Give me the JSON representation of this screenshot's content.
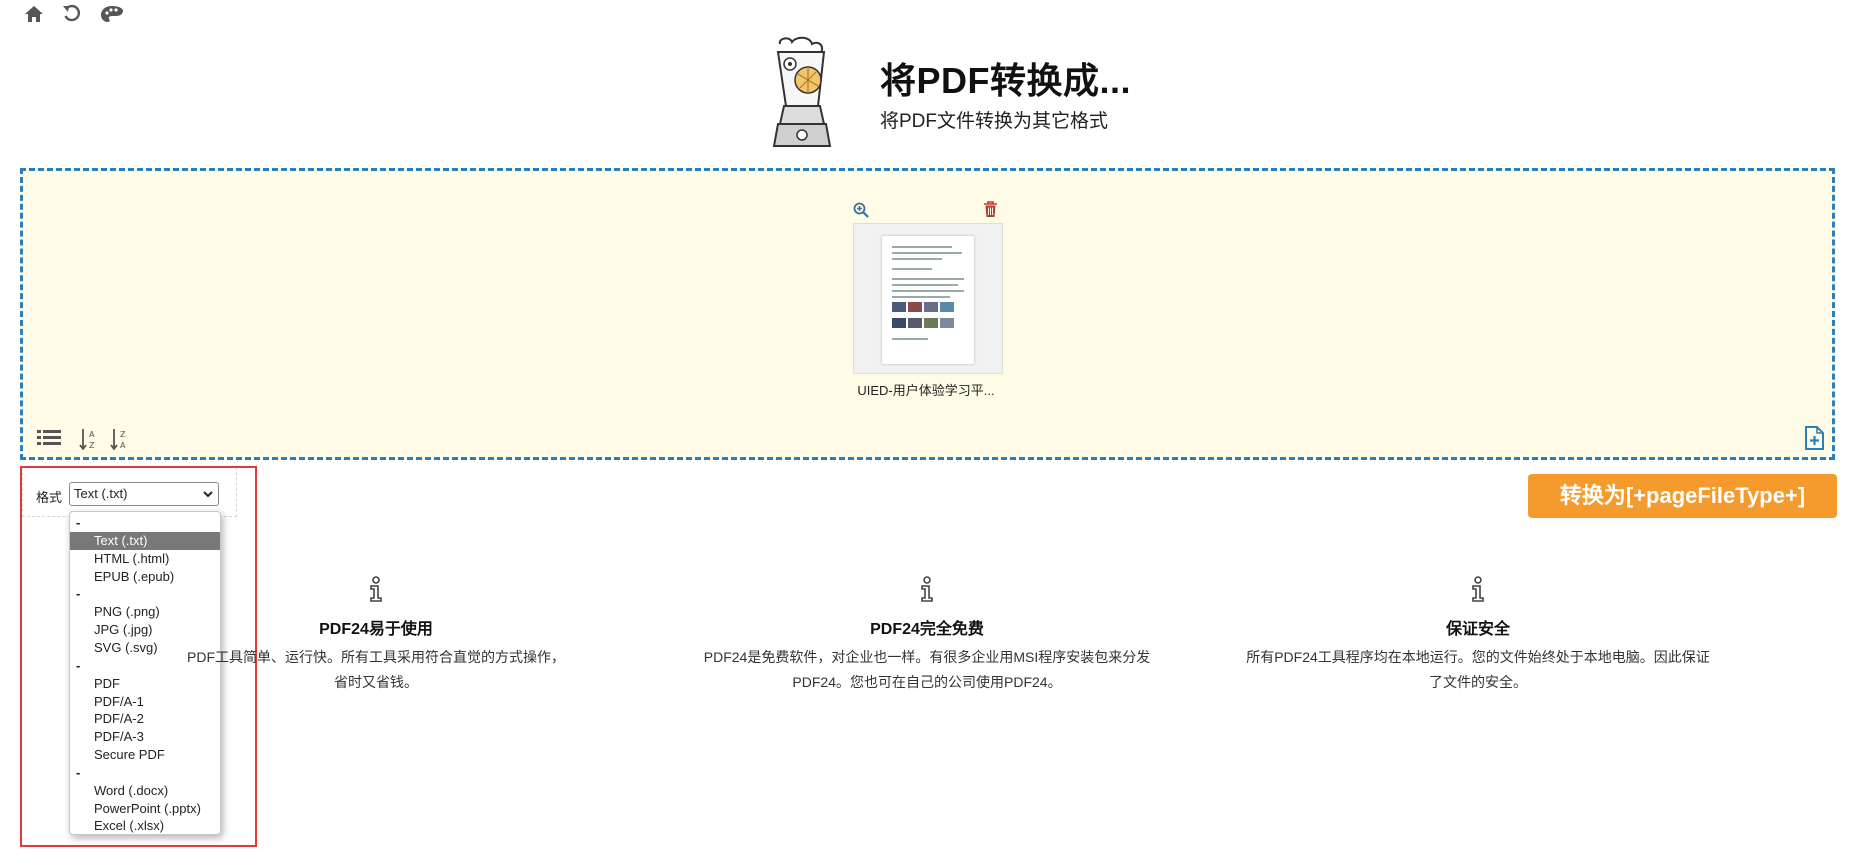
{
  "toolbar": {
    "icons": [
      "home-icon",
      "undo-icon",
      "palette-icon"
    ]
  },
  "header": {
    "title": "将PDF转换成...",
    "subtitle": "将PDF文件转换为其它格式"
  },
  "file": {
    "name": "UIED-用户体验学习平..."
  },
  "format": {
    "label": "格式",
    "selected": "Text (.txt)",
    "options": [
      {
        "label": "-",
        "separator": true
      },
      {
        "label": "Text (.txt)",
        "selected": true
      },
      {
        "label": "HTML (.html)"
      },
      {
        "label": "EPUB (.epub)"
      },
      {
        "label": "-",
        "separator": true
      },
      {
        "label": "PNG (.png)"
      },
      {
        "label": "JPG (.jpg)"
      },
      {
        "label": "SVG (.svg)"
      },
      {
        "label": "-",
        "separator": true
      },
      {
        "label": "PDF"
      },
      {
        "label": "PDF/A-1"
      },
      {
        "label": "PDF/A-2"
      },
      {
        "label": "PDF/A-3"
      },
      {
        "label": "Secure PDF"
      },
      {
        "label": "-",
        "separator": true
      },
      {
        "label": "Word (.docx)"
      },
      {
        "label": "PowerPoint (.pptx)"
      },
      {
        "label": "Excel (.xlsx)"
      }
    ]
  },
  "convert": {
    "label": "转换为[+pageFileType+]"
  },
  "features": [
    {
      "title": "PDF24易于使用",
      "line1": "PDF工具简单、运行快。所有工具采用符合直觉的方式操作，",
      "line2": "省时又省钱。"
    },
    {
      "title": "PDF24完全免费",
      "line1": "PDF24是免费软件，对企业也一样。有很多企业用MSI程序安装包来分发",
      "line2": "PDF24。您也可在自己的公司使用PDF24。"
    },
    {
      "title": "保证安全",
      "line1": "所有PDF24工具程序均在本地运行。您的文件始终处于本地电脑。因此保证",
      "line2": "了文件的安全。"
    }
  ],
  "colors": {
    "accent": "#f59a2d",
    "dropzone_bg": "#fefce6",
    "dropzone_border": "#2a7fbf",
    "highlight": "#e03a3a"
  }
}
